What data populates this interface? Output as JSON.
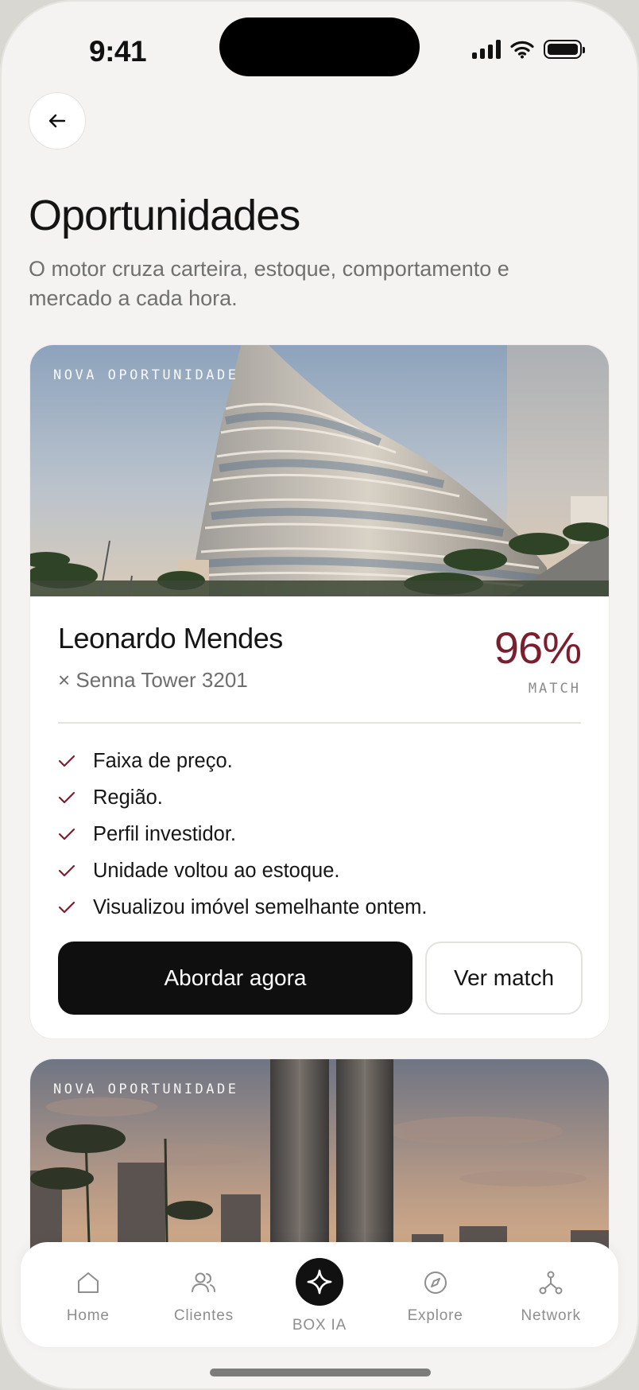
{
  "status_bar": {
    "time": "9:41"
  },
  "header": {
    "title": "Oportunidades",
    "subtitle": "O motor cruza carteira, estoque, comportamento e mercado a cada hora."
  },
  "cards": [
    {
      "tag": "NOVA OPORTUNIDADE",
      "client_name": "Leonardo Mendes",
      "property": "× Senna Tower 3201",
      "match_percent": "96%",
      "match_label": "MATCH",
      "reasons": [
        "Faixa de preço.",
        "Região.",
        "Perfil investidor.",
        "Unidade voltou ao estoque.",
        "Visualizou imóvel semelhante ontem."
      ],
      "primary_action": "Abordar agora",
      "secondary_action": "Ver match"
    },
    {
      "tag": "NOVA OPORTUNIDADE"
    }
  ],
  "tabbar": {
    "items": [
      {
        "label": "Home",
        "icon": "home-icon"
      },
      {
        "label": "Clientes",
        "icon": "users-icon"
      },
      {
        "label": "BOX IA",
        "icon": "sparkle-icon"
      },
      {
        "label": "Explore",
        "icon": "compass-icon"
      },
      {
        "label": "Network",
        "icon": "network-icon"
      }
    ]
  },
  "colors": {
    "accent": "#7b1f2e",
    "background": "#f4f3f1",
    "primary_button": "#0f0f0f"
  }
}
